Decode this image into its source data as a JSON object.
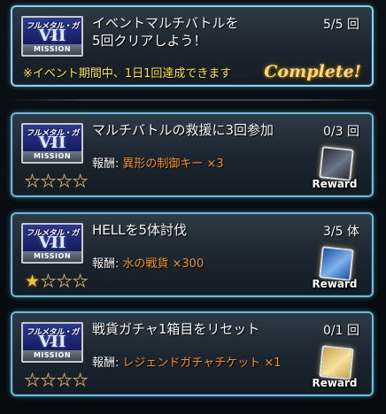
{
  "badge": {
    "top_text": "フルメタル・ガイ",
    "numeral": "VII",
    "footer": "MISSION"
  },
  "event_mission": {
    "title_line1": "イベントマルチバトルを",
    "title_line2": "5回クリアしよう！",
    "progress": "5/5 回",
    "notice": "※イベント期間中、1日1回達成できます",
    "status": "Complete!"
  },
  "reward_label": "報酬:",
  "reward_button_text": "Reward",
  "missions": [
    {
      "title": "マルチバトルの救援に3回参加",
      "progress": "0/3 回",
      "reward_item": "異形の制御キー ×3",
      "stars_filled": 0,
      "stars_total": 4,
      "reward_icon": "control-key-icon",
      "reward_colors": [
        "#2a2a33",
        "#6c7788"
      ]
    },
    {
      "title": "HELLを5体討伐",
      "progress": "3/5 体",
      "reward_item": "水の戦貨 ×300",
      "stars_filled": 1,
      "stars_total": 4,
      "reward_icon": "water-medal-icon",
      "reward_colors": [
        "#1e4d9a",
        "#7fb2f0"
      ]
    },
    {
      "title": "戦貨ガチャ1箱目をリセット",
      "progress": "0/1 回",
      "reward_item": "レジェンドガチャチケット ×1",
      "stars_filled": 0,
      "stars_total": 4,
      "reward_icon": "gacha-ticket-icon",
      "reward_colors": [
        "#c8a24a",
        "#f6e2a0"
      ]
    }
  ],
  "colors": {
    "card_border": "#6fb7d2",
    "notice": "#ffe14a",
    "reward_item": "#f0922a",
    "star": "#f2c33a",
    "complete": "#f6d680"
  }
}
